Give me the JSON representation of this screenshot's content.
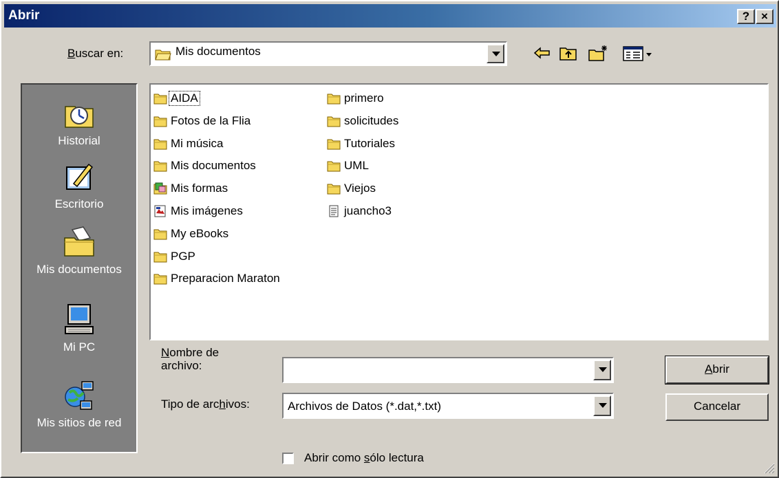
{
  "window": {
    "title": "Abrir",
    "help_label": "?",
    "close_label": "×"
  },
  "lookin": {
    "label_prefix": "",
    "label_key": "B",
    "label_rest": "uscar en:",
    "value": "Mis documentos"
  },
  "places": [
    {
      "label": "Historial"
    },
    {
      "label": "Escritorio"
    },
    {
      "label": "Mis documentos"
    },
    {
      "label": "Mi PC"
    },
    {
      "label": "Mis sitios de red"
    }
  ],
  "files": {
    "col1": [
      "AIDA",
      "Fotos de la Flia",
      "Mi música",
      "Mis documentos",
      "Mis formas",
      "Mis imágenes",
      "My eBooks",
      "PGP",
      "Preparacion Maraton"
    ],
    "col2": [
      "primero",
      "solicitudes",
      "Tutoriales",
      "UML",
      "Viejos",
      "juancho3"
    ]
  },
  "filename": {
    "label_key": "N",
    "label_rest": "ombre de",
    "label_line2": "archivo:",
    "value": ""
  },
  "filetype": {
    "label_prefix": "Tipo de arc",
    "label_key": "h",
    "label_rest": "ivos:",
    "value": "Archivos de Datos (*.dat,*.txt)"
  },
  "buttons": {
    "open_key": "A",
    "open_rest": "brir",
    "cancel": "Cancelar"
  },
  "readonly": {
    "prefix": "Abrir como ",
    "key": "s",
    "rest": "ólo lectura"
  },
  "colors": {
    "face": "#d4d0c8",
    "title_start": "#0a246a",
    "title_end": "#a6caf0",
    "folder": "#f5d75c",
    "places_bg": "#808080"
  }
}
